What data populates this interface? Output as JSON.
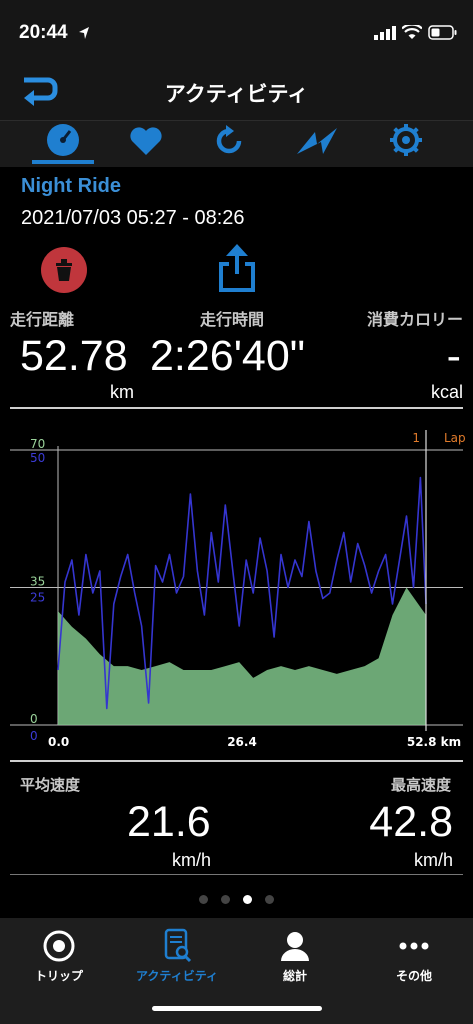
{
  "status": {
    "time": "20:44"
  },
  "header": {
    "title": "アクティビティ"
  },
  "tabs": [
    "speed",
    "heart-rate",
    "cadence",
    "power",
    "gear"
  ],
  "ride": {
    "name": "Night Ride",
    "datetime": "2021/07/03 05:27 - 08:26"
  },
  "stats": {
    "distance": {
      "label": "走行距離",
      "value": "52.78",
      "unit": "km"
    },
    "time": {
      "label": "走行時間",
      "value": "2:26'40\""
    },
    "calories": {
      "label": "消費カロリー",
      "value": "-",
      "unit": "kcal"
    }
  },
  "chart_data": {
    "type": "area",
    "x_unit": "km",
    "x_ticks": [
      "0.0",
      "26.4",
      "52.8 km"
    ],
    "left_axis_elevation": {
      "ticks": [
        "70",
        "35",
        "0"
      ],
      "ylim": [
        0,
        70
      ],
      "color": "#9ad29a"
    },
    "left_axis_speed": {
      "ticks": [
        "50",
        "25",
        "0"
      ],
      "ylim": [
        0,
        50
      ],
      "color": "#3b3bd6"
    },
    "lap": {
      "label": "Lap",
      "number": "1",
      "x": 52.8,
      "color": "#e07a2a"
    },
    "series": [
      {
        "name": "",
        "kind": "area",
        "color": "#7fc48a",
        "x": [
          0,
          2,
          4,
          6,
          8,
          10,
          12,
          14,
          16,
          18,
          20,
          22,
          24,
          26,
          28,
          30,
          32,
          34,
          36,
          38,
          40,
          42,
          44,
          46,
          48,
          50,
          52,
          52.8
        ],
        "values": [
          29,
          25,
          22,
          18,
          15,
          15,
          14,
          15,
          16,
          14,
          14,
          14,
          15,
          16,
          12,
          14,
          15,
          14,
          15,
          14,
          13,
          14,
          15,
          17,
          28,
          35,
          30,
          28
        ]
      },
      {
        "name": "",
        "kind": "line",
        "color": "#3535d0",
        "x": [
          0,
          1,
          2,
          3,
          4,
          5,
          6,
          7,
          8,
          9,
          10,
          11,
          12,
          13,
          14,
          15,
          16,
          17,
          18,
          19,
          20,
          21,
          22,
          23,
          24,
          25,
          26,
          27,
          28,
          29,
          30,
          31,
          32,
          33,
          34,
          35,
          36,
          37,
          38,
          39,
          40,
          41,
          42,
          43,
          44,
          45,
          46,
          47,
          48,
          49,
          50,
          51,
          52,
          52.8
        ],
        "values": [
          10,
          26,
          30,
          20,
          31,
          24,
          28,
          3,
          22,
          27,
          31,
          24,
          18,
          4,
          29,
          26,
          31,
          24,
          27,
          42,
          28,
          20,
          35,
          26,
          40,
          29,
          18,
          30,
          24,
          34,
          28,
          16,
          31,
          25,
          30,
          27,
          37,
          28,
          23,
          24,
          30,
          35,
          26,
          33,
          29,
          24,
          28,
          31,
          22,
          30,
          38,
          25,
          45,
          22
        ]
      }
    ]
  },
  "bottom_stats": {
    "avg": {
      "label": "平均速度",
      "value": "21.6",
      "unit": "km/h"
    },
    "max": {
      "label": "最高速度",
      "value": "42.8",
      "unit": "km/h"
    }
  },
  "page_dots": {
    "count": 4,
    "active": 3
  },
  "bottom_nav": [
    {
      "label": "トリップ",
      "icon": "target-icon"
    },
    {
      "label": "アクティビティ",
      "icon": "activity-doc-icon"
    },
    {
      "label": "総計",
      "icon": "person-icon"
    },
    {
      "label": "その他",
      "icon": "more-icon"
    }
  ],
  "colors": {
    "accent": "#1f7fd0",
    "delete": "#c0363c"
  }
}
